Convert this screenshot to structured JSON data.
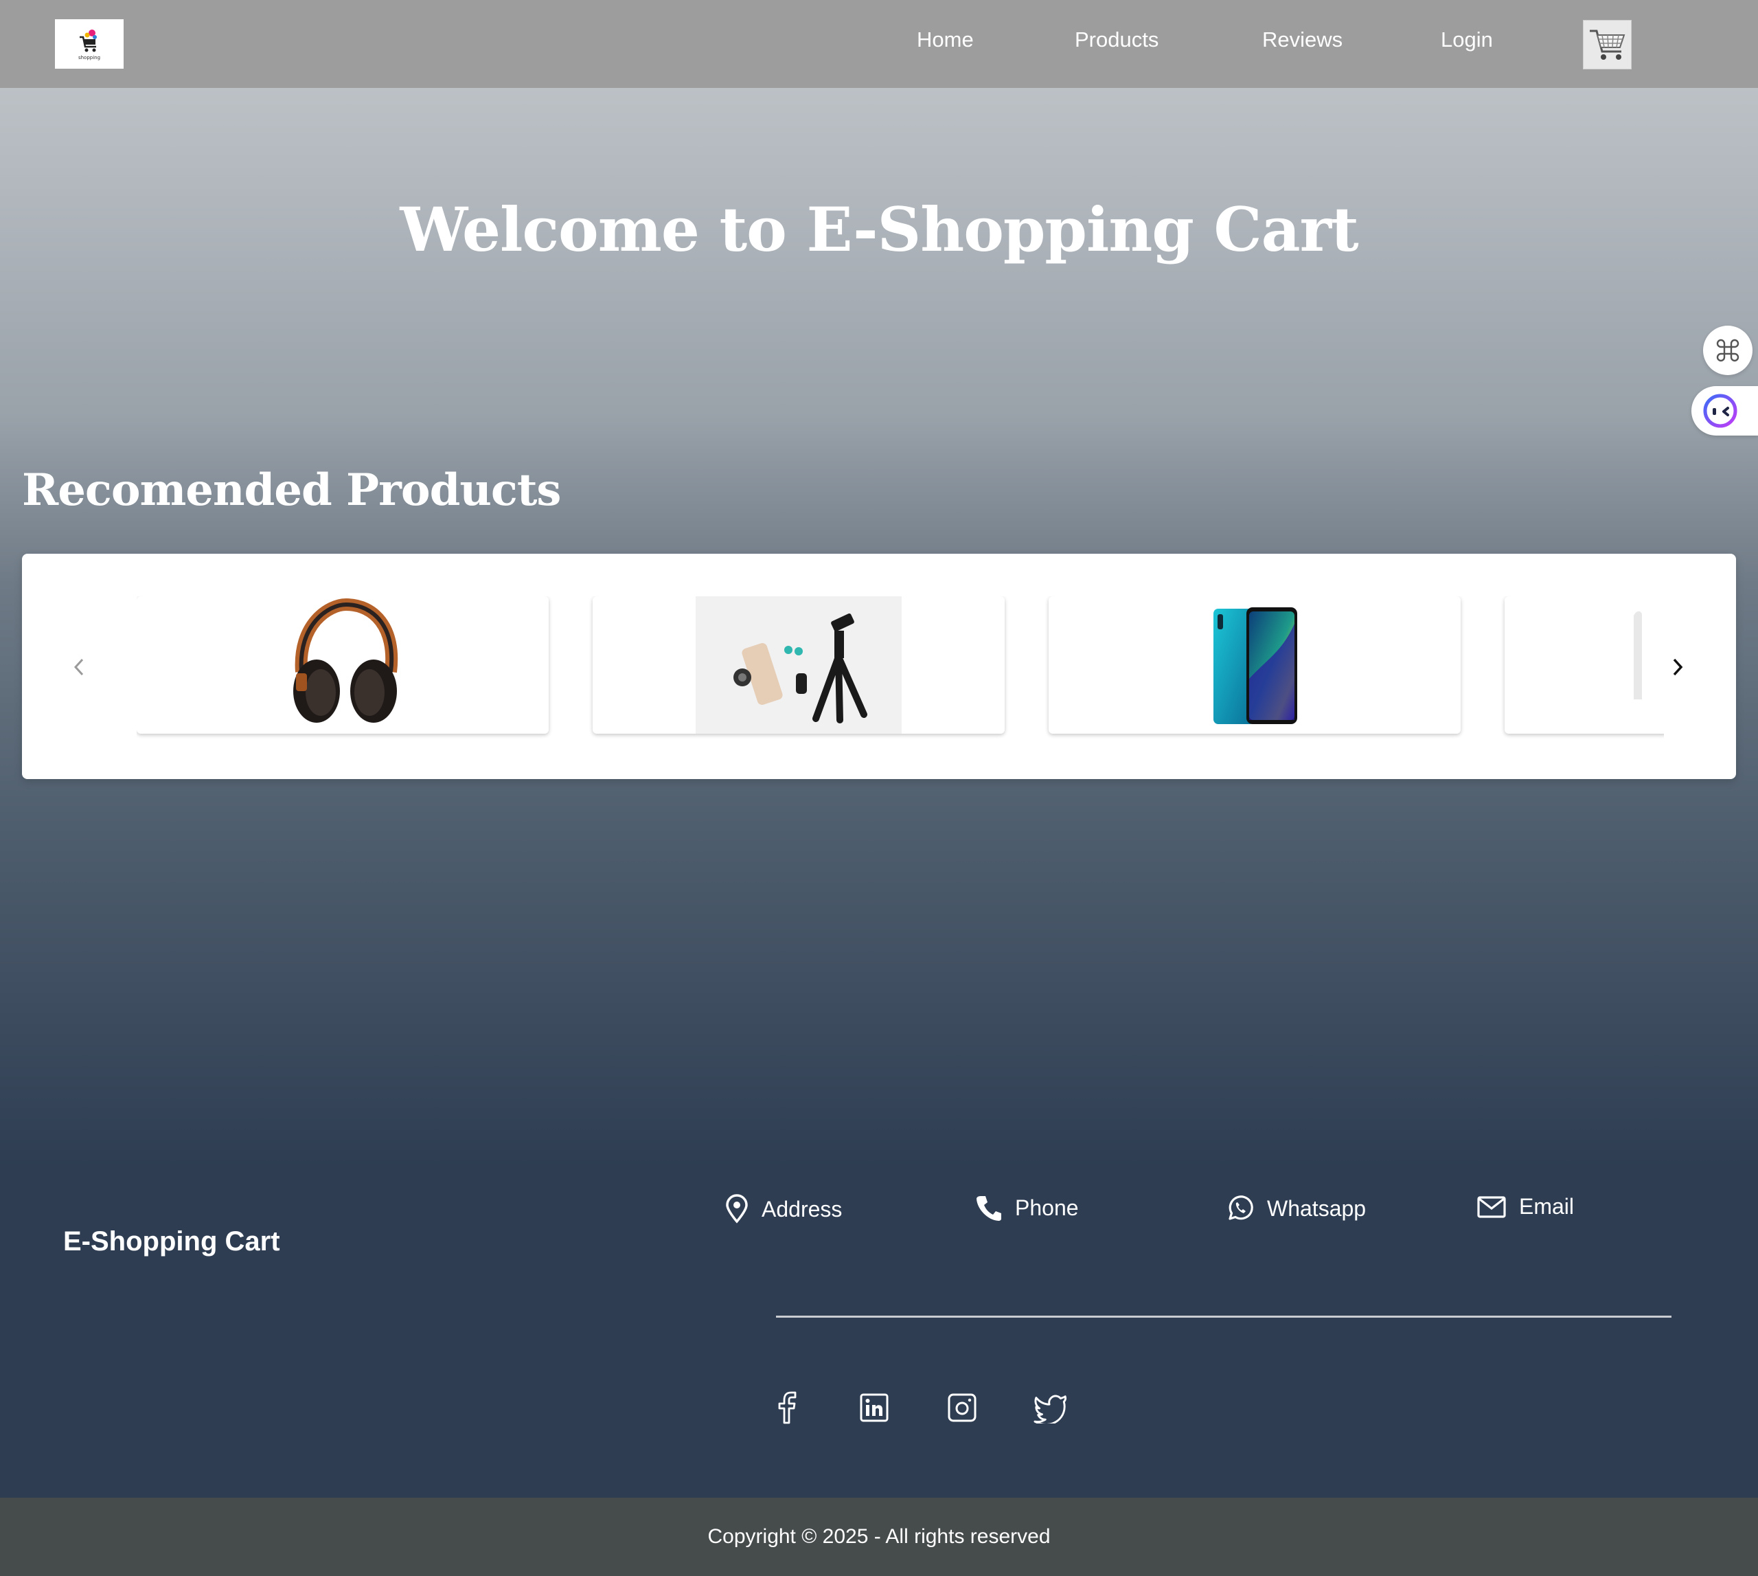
{
  "navbar": {
    "logo_text": "shopping",
    "links": [
      "Home",
      "Products",
      "Reviews",
      "Login"
    ],
    "cart_icon": "shopping-cart-icon"
  },
  "hero": {
    "title": "Welcome to E-Shopping Cart"
  },
  "recommended": {
    "title": "Recomended Products",
    "products": [
      {
        "icon": "headphones-image"
      },
      {
        "icon": "phone-accessories-image"
      },
      {
        "icon": "smartphone-image"
      },
      {
        "icon": "product-image-partial"
      }
    ],
    "prev_icon": "chevron-left-icon",
    "next_icon": "chevron-right-icon"
  },
  "footer": {
    "brand": "E-Shopping Cart",
    "contacts": [
      {
        "icon": "map-pin-icon",
        "label": "Address"
      },
      {
        "icon": "phone-icon",
        "label": "Phone"
      },
      {
        "icon": "whatsapp-icon",
        "label": "Whatsapp"
      },
      {
        "icon": "mail-icon",
        "label": "Email"
      }
    ],
    "social": [
      "facebook-icon",
      "linkedin-icon",
      "instagram-icon",
      "twitter-icon"
    ],
    "copyright": "Copyright © 2025 - All rights reserved"
  },
  "colors": {
    "navbar_bg": "#9d9d9d",
    "footer_bg": "#2e3d52",
    "copyright_bg": "#464b4c"
  }
}
